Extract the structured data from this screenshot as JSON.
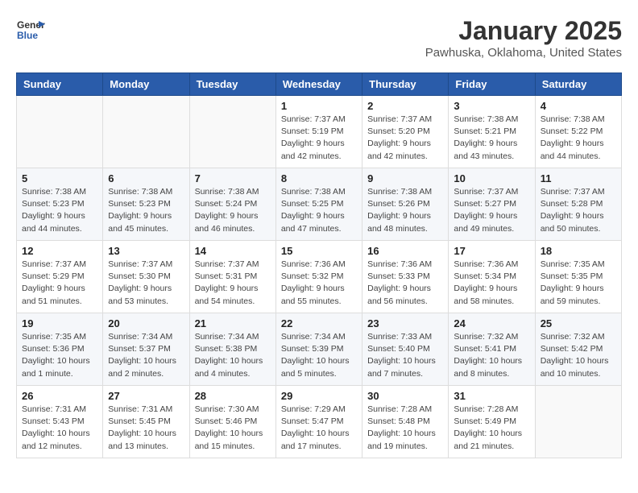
{
  "header": {
    "logo_general": "General",
    "logo_blue": "Blue",
    "title": "January 2025",
    "location": "Pawhuska, Oklahoma, United States"
  },
  "days_of_week": [
    "Sunday",
    "Monday",
    "Tuesday",
    "Wednesday",
    "Thursday",
    "Friday",
    "Saturday"
  ],
  "weeks": [
    [
      {
        "day": "",
        "info": ""
      },
      {
        "day": "",
        "info": ""
      },
      {
        "day": "",
        "info": ""
      },
      {
        "day": "1",
        "info": "Sunrise: 7:37 AM\nSunset: 5:19 PM\nDaylight: 9 hours and 42 minutes."
      },
      {
        "day": "2",
        "info": "Sunrise: 7:37 AM\nSunset: 5:20 PM\nDaylight: 9 hours and 42 minutes."
      },
      {
        "day": "3",
        "info": "Sunrise: 7:38 AM\nSunset: 5:21 PM\nDaylight: 9 hours and 43 minutes."
      },
      {
        "day": "4",
        "info": "Sunrise: 7:38 AM\nSunset: 5:22 PM\nDaylight: 9 hours and 44 minutes."
      }
    ],
    [
      {
        "day": "5",
        "info": "Sunrise: 7:38 AM\nSunset: 5:23 PM\nDaylight: 9 hours and 44 minutes."
      },
      {
        "day": "6",
        "info": "Sunrise: 7:38 AM\nSunset: 5:23 PM\nDaylight: 9 hours and 45 minutes."
      },
      {
        "day": "7",
        "info": "Sunrise: 7:38 AM\nSunset: 5:24 PM\nDaylight: 9 hours and 46 minutes."
      },
      {
        "day": "8",
        "info": "Sunrise: 7:38 AM\nSunset: 5:25 PM\nDaylight: 9 hours and 47 minutes."
      },
      {
        "day": "9",
        "info": "Sunrise: 7:38 AM\nSunset: 5:26 PM\nDaylight: 9 hours and 48 minutes."
      },
      {
        "day": "10",
        "info": "Sunrise: 7:37 AM\nSunset: 5:27 PM\nDaylight: 9 hours and 49 minutes."
      },
      {
        "day": "11",
        "info": "Sunrise: 7:37 AM\nSunset: 5:28 PM\nDaylight: 9 hours and 50 minutes."
      }
    ],
    [
      {
        "day": "12",
        "info": "Sunrise: 7:37 AM\nSunset: 5:29 PM\nDaylight: 9 hours and 51 minutes."
      },
      {
        "day": "13",
        "info": "Sunrise: 7:37 AM\nSunset: 5:30 PM\nDaylight: 9 hours and 53 minutes."
      },
      {
        "day": "14",
        "info": "Sunrise: 7:37 AM\nSunset: 5:31 PM\nDaylight: 9 hours and 54 minutes."
      },
      {
        "day": "15",
        "info": "Sunrise: 7:36 AM\nSunset: 5:32 PM\nDaylight: 9 hours and 55 minutes."
      },
      {
        "day": "16",
        "info": "Sunrise: 7:36 AM\nSunset: 5:33 PM\nDaylight: 9 hours and 56 minutes."
      },
      {
        "day": "17",
        "info": "Sunrise: 7:36 AM\nSunset: 5:34 PM\nDaylight: 9 hours and 58 minutes."
      },
      {
        "day": "18",
        "info": "Sunrise: 7:35 AM\nSunset: 5:35 PM\nDaylight: 9 hours and 59 minutes."
      }
    ],
    [
      {
        "day": "19",
        "info": "Sunrise: 7:35 AM\nSunset: 5:36 PM\nDaylight: 10 hours and 1 minute."
      },
      {
        "day": "20",
        "info": "Sunrise: 7:34 AM\nSunset: 5:37 PM\nDaylight: 10 hours and 2 minutes."
      },
      {
        "day": "21",
        "info": "Sunrise: 7:34 AM\nSunset: 5:38 PM\nDaylight: 10 hours and 4 minutes."
      },
      {
        "day": "22",
        "info": "Sunrise: 7:34 AM\nSunset: 5:39 PM\nDaylight: 10 hours and 5 minutes."
      },
      {
        "day": "23",
        "info": "Sunrise: 7:33 AM\nSunset: 5:40 PM\nDaylight: 10 hours and 7 minutes."
      },
      {
        "day": "24",
        "info": "Sunrise: 7:32 AM\nSunset: 5:41 PM\nDaylight: 10 hours and 8 minutes."
      },
      {
        "day": "25",
        "info": "Sunrise: 7:32 AM\nSunset: 5:42 PM\nDaylight: 10 hours and 10 minutes."
      }
    ],
    [
      {
        "day": "26",
        "info": "Sunrise: 7:31 AM\nSunset: 5:43 PM\nDaylight: 10 hours and 12 minutes."
      },
      {
        "day": "27",
        "info": "Sunrise: 7:31 AM\nSunset: 5:45 PM\nDaylight: 10 hours and 13 minutes."
      },
      {
        "day": "28",
        "info": "Sunrise: 7:30 AM\nSunset: 5:46 PM\nDaylight: 10 hours and 15 minutes."
      },
      {
        "day": "29",
        "info": "Sunrise: 7:29 AM\nSunset: 5:47 PM\nDaylight: 10 hours and 17 minutes."
      },
      {
        "day": "30",
        "info": "Sunrise: 7:28 AM\nSunset: 5:48 PM\nDaylight: 10 hours and 19 minutes."
      },
      {
        "day": "31",
        "info": "Sunrise: 7:28 AM\nSunset: 5:49 PM\nDaylight: 10 hours and 21 minutes."
      },
      {
        "day": "",
        "info": ""
      }
    ]
  ]
}
